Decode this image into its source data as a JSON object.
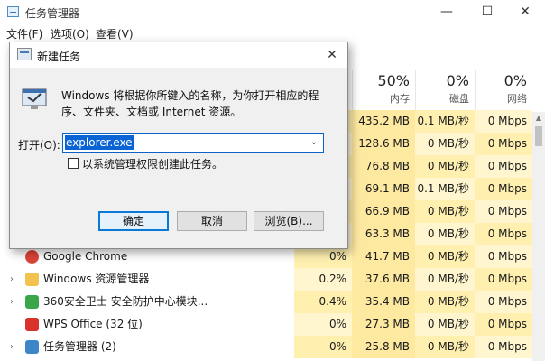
{
  "taskmanager": {
    "title": "任务管理器",
    "window_controls": {
      "minimize": "—",
      "maximize": "☐",
      "close": "✕"
    },
    "menu": [
      "文件(F)",
      "选项(O)",
      "查看(V)"
    ],
    "columns": [
      {
        "pct": "50%",
        "name": "内存"
      },
      {
        "pct": "0%",
        "name": "磁盘"
      },
      {
        "pct": "0%",
        "name": "网络"
      }
    ],
    "rows": [
      {
        "name": "",
        "cpu": "",
        "mem": "435.2 MB",
        "disk": "0.1 MB/秒",
        "net": "0 Mbps"
      },
      {
        "name": "",
        "cpu": "",
        "mem": "128.6 MB",
        "disk": "0 MB/秒",
        "net": "0 Mbps"
      },
      {
        "name": "",
        "cpu": "",
        "mem": "76.8 MB",
        "disk": "0 MB/秒",
        "net": "0 Mbps"
      },
      {
        "name": "",
        "cpu": "",
        "mem": "69.1 MB",
        "disk": "0.1 MB/秒",
        "net": "0 Mbps"
      },
      {
        "name": "",
        "cpu": "",
        "mem": "66.9 MB",
        "disk": "0 MB/秒",
        "net": "0 Mbps"
      },
      {
        "name": "",
        "cpu": "",
        "mem": "63.3 MB",
        "disk": "0 MB/秒",
        "net": "0 Mbps"
      },
      {
        "name": "Google Chrome",
        "cpu": "0%",
        "mem": "41.7 MB",
        "disk": "0 MB/秒",
        "net": "0 Mbps",
        "expander": "",
        "icon": "chrome-icon",
        "icon_color": "#db4437"
      },
      {
        "name": "Windows 资源管理器",
        "cpu": "0.2%",
        "mem": "37.6 MB",
        "disk": "0 MB/秒",
        "net": "0 Mbps",
        "expander": "›",
        "icon": "folder-icon",
        "icon_color": "#f2c14e"
      },
      {
        "name": "360安全卫士 安全防护中心模块...",
        "cpu": "0.4%",
        "mem": "35.4 MB",
        "disk": "0 MB/秒",
        "net": "0 Mbps",
        "expander": "›",
        "icon": "shield-icon",
        "icon_color": "#3aa64a"
      },
      {
        "name": "WPS Office (32 位)",
        "cpu": "0%",
        "mem": "27.3 MB",
        "disk": "0 MB/秒",
        "net": "0 Mbps",
        "expander": "",
        "icon": "wps-icon",
        "icon_color": "#d9312b"
      },
      {
        "name": "任务管理器 (2)",
        "cpu": "0%",
        "mem": "25.8 MB",
        "disk": "0 MB/秒",
        "net": "0 Mbps",
        "expander": "›",
        "icon": "taskmanager-icon",
        "icon_color": "#3d87c9"
      }
    ]
  },
  "dialog": {
    "title": "新建任务",
    "close": "✕",
    "description": "Windows 将根据你所键入的名称，为你打开相应的程序、文件夹、文档或 Internet 资源。",
    "open_label": "打开(O):",
    "input_value": "explorer.exe",
    "checkbox_label": "以系统管理权限创建此任务。",
    "buttons": {
      "ok": "确定",
      "cancel": "取消",
      "browse": "浏览(B)..."
    }
  },
  "colors": {
    "accent": "#0a64d6",
    "heat_light": "#fff6cf",
    "heat_dark": "#fde9a0"
  }
}
